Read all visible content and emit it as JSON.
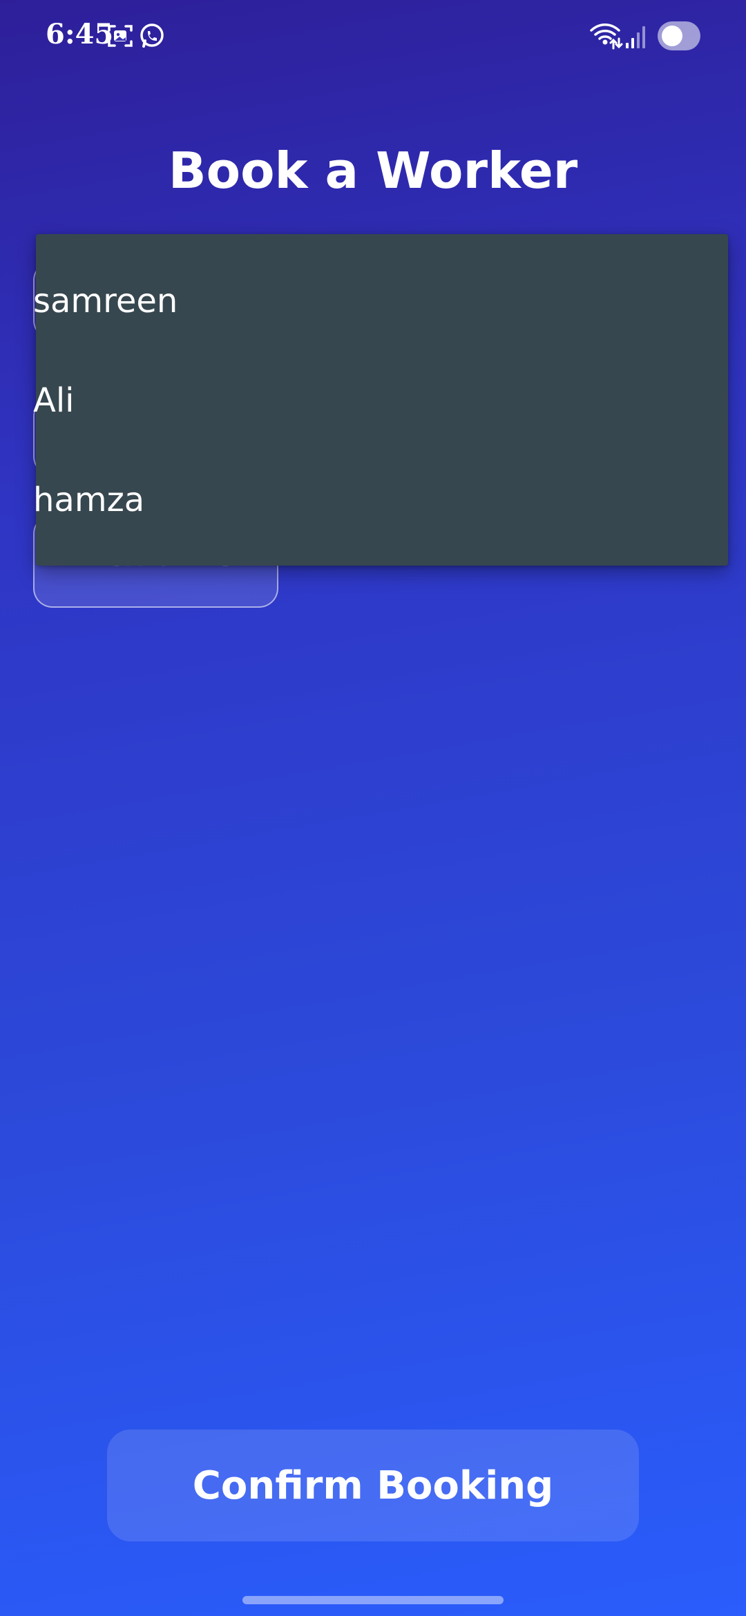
{
  "status_bar": {
    "time": "6:45",
    "icons": [
      "screenshot-icon",
      "whatsapp-icon",
      "wifi-icon",
      "signal-icon",
      "battery-toggle-icon"
    ]
  },
  "page": {
    "title": "Book a Worker"
  },
  "dropdown": {
    "options": [
      "samreen",
      "Ali",
      "hamza"
    ]
  },
  "form": {
    "pick_time_label": "Pick Time"
  },
  "actions": {
    "confirm_label": "Confirm Booking"
  },
  "colors": {
    "gradient_top": "#2e1f99",
    "gradient_bottom": "#2a5dfc",
    "dropdown_bg": "#37474f"
  }
}
